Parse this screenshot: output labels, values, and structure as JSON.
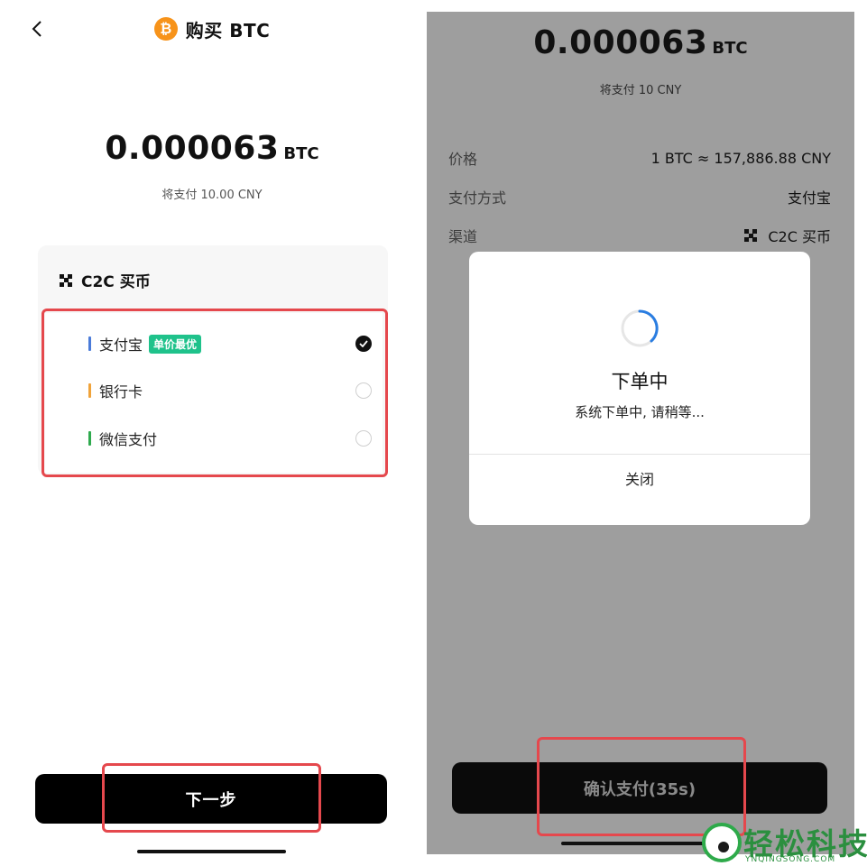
{
  "left": {
    "header": {
      "title": "购买 BTC",
      "coin_symbol": "₿"
    },
    "amount": {
      "value": "0.000063",
      "unit": "BTC"
    },
    "pay_text": "将支付 10.00 CNY",
    "channel": {
      "title": "C2C 买币"
    },
    "methods": [
      {
        "label": "支付宝",
        "badge": "单价最优",
        "bar_color": "#4a7bd9",
        "selected": true
      },
      {
        "label": "银行卡",
        "badge": "",
        "bar_color": "#f0a33a",
        "selected": false
      },
      {
        "label": "微信支付",
        "badge": "",
        "bar_color": "#2faa4e",
        "selected": false
      }
    ],
    "next_label": "下一步"
  },
  "right": {
    "amount": {
      "value": "0.000063",
      "unit": "BTC"
    },
    "pay_text": "将支付 10 CNY",
    "info": {
      "price_key": "价格",
      "price_val": "1 BTC ≈ 157,886.88 CNY",
      "method_key": "支付方式",
      "method_val": "支付宝",
      "channel_key": "渠道",
      "channel_val": "C2C 买币"
    },
    "dialog": {
      "title": "下单中",
      "message": "系统下单中, 请稍等...",
      "close_label": "关闭"
    },
    "confirm_label": "确认支付(35s)"
  },
  "watermark": {
    "brand": "轻松科技",
    "domain": "YNQINGSONG.COM"
  },
  "colors": {
    "highlight": "#e5484d",
    "badge": "#1fc28b",
    "btc_orange": "#f7931a",
    "spinner": "#2a7de1"
  }
}
